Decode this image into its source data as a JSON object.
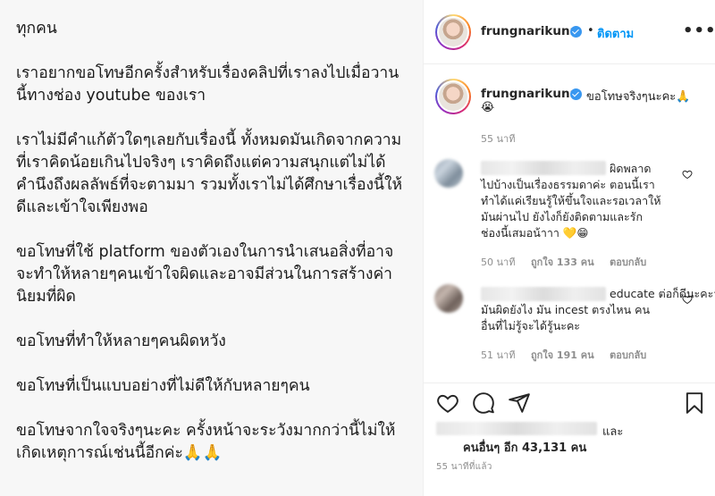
{
  "post": {
    "paragraphs": [
      "ทุกคน",
      "เราอยากขอโทษอีกครั้งสำหรับเรื่องคลิปที่เราลงไปเมื่อวานนี้ทางช่อง youtube ของเรา",
      "เราไม่มีคำแก้ตัวใดๆเลยกับเรื่องนี้ ทั้งหมดมันเกิดจากความที่เราคิดน้อยเกินไปจริงๆ เราคิดถึงแต่ความสนุกแต่ไม่ได้คำนึงถึงผลลัพธ์ที่จะตามมา รวมทั้งเราไม่ได้ศึกษาเรื่องนี้ให้ดีและเข้าใจเพียงพอ",
      "ขอโทษที่ใช้ platform ของตัวเองในการนำเสนอสิ่งที่อาจจะทำให้หลายๆคนเข้าใจผิดและอาจมีส่วนในการสร้างค่านิยมที่ผิด",
      "ขอโทษที่ทำให้หลายๆคนผิดหวัง",
      "ขอโทษที่เป็นแบบอย่างที่ไม่ดีให้กับหลายๆคน",
      "ขอโทษจากใจจริงๆนะคะ ครั้งหน้าจะระวังมากกว่านี้ไม่ให้เกิดเหตุการณ์เช่นนี้อีกค่ะ🙏🙏"
    ]
  },
  "header": {
    "username": "frungnarikunn",
    "separator": "•",
    "follow_label": "ติดตาม",
    "more_label": "•••"
  },
  "caption": {
    "username": "frungnarikunn",
    "text": "ขอโทษจริงๆนะคะ🙏",
    "emoji_line": "😭",
    "time": "55 นาที"
  },
  "comments": [
    {
      "lines": [
        "ผิดพลาด",
        "ไปบ้างเป็นเรื่องธรรมดาค่ะ ตอนนี้เรา",
        "ทำได้แค่เรียนรู้ให้ขึ้นใจและรอเวลาให้",
        "มันผ่านไป ยังไงก็ยังติดตามและรัก",
        "ช่องนี้เสมอน้าาา 💛😁"
      ],
      "time": "50 นาที",
      "likes": "ถูกใจ 133 คน",
      "reply": "ตอบกลับ"
    },
    {
      "lines": [
        "educate ต่อก็ดีนะคะว่า",
        "มันผิดยังไง มัน incest ตรงไหน คน",
        "อื่นที่ไม่รู้จะได้รู้นะคะ"
      ],
      "time": "51 นาที",
      "likes": "ถูกใจ 191 คน",
      "reply": "ตอบกลับ"
    }
  ],
  "likes_summary": {
    "and_label": "และ",
    "others_label": "คนอื่นๆ อีก 43,131 คน"
  },
  "posted_time": "55 นาทีที่แล้ว",
  "icons": {
    "like": "heart-icon",
    "comment": "comment-bubble-icon",
    "share": "paper-plane-icon",
    "save": "bookmark-icon"
  },
  "colors": {
    "follow": "#0095f6",
    "verified": "#3897f0",
    "secondary_text": "#8e8e8e"
  }
}
